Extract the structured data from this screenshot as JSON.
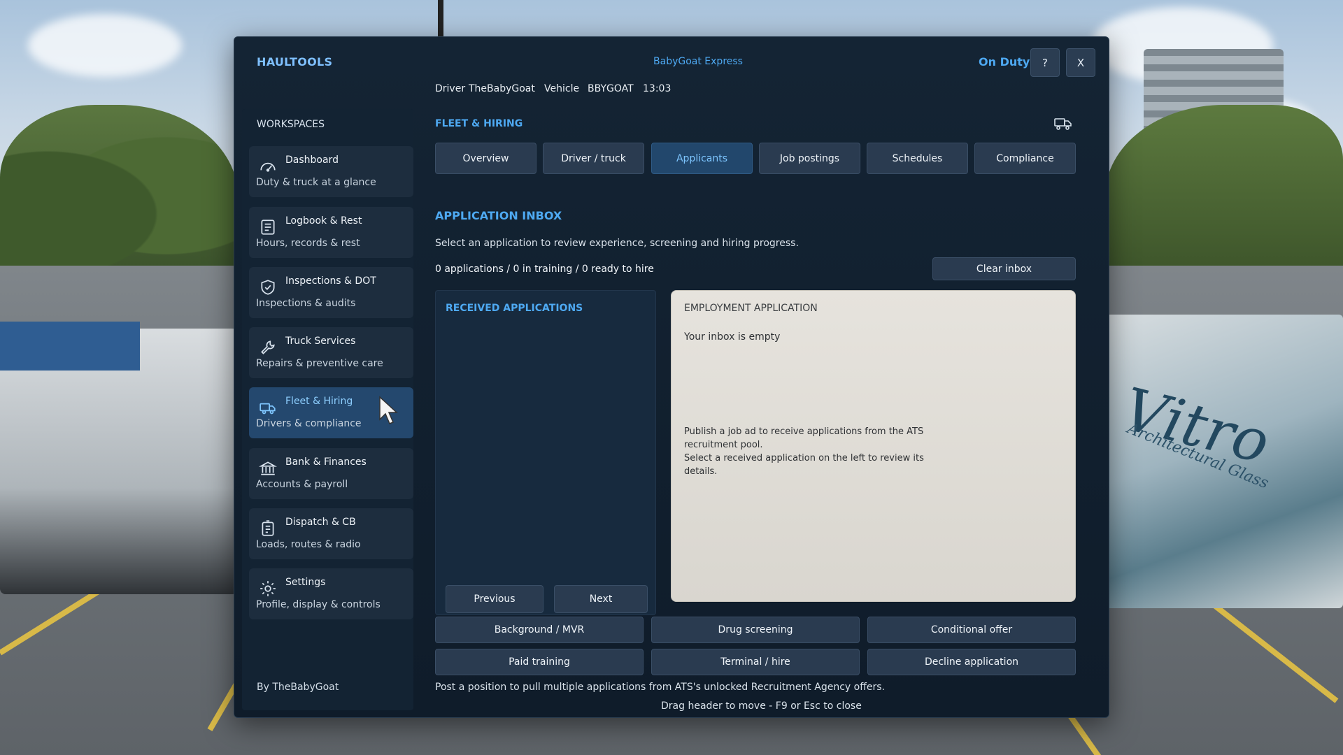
{
  "header": {
    "brand": "HAULTOOLS",
    "company": "BabyGoat Express",
    "status": "On Duty",
    "help_label": "?",
    "close_label": "X",
    "driver_label": "Driver",
    "driver_name": "TheBabyGoat",
    "vehicle_label": "Vehicle",
    "vehicle_id": "BBYGOAT",
    "clock": "13:03"
  },
  "sidebar": {
    "title": "WORKSPACES",
    "items": [
      {
        "label": "Dashboard",
        "sub": "Duty & truck at a glance",
        "icon": "gauge-icon"
      },
      {
        "label": "Logbook & Rest",
        "sub": "Hours, records & rest",
        "icon": "logbook-icon"
      },
      {
        "label": "Inspections & DOT",
        "sub": "Inspections & audits",
        "icon": "shield-check-icon"
      },
      {
        "label": "Truck Services",
        "sub": "Repairs & preventive care",
        "icon": "wrench-icon"
      },
      {
        "label": "Fleet & Hiring",
        "sub": "Drivers & compliance",
        "icon": "truck-icon",
        "active": true
      },
      {
        "label": "Bank & Finances",
        "sub": "Accounts & payroll",
        "icon": "bank-icon"
      },
      {
        "label": "Dispatch & CB",
        "sub": "Loads, routes & radio",
        "icon": "dispatch-icon"
      },
      {
        "label": "Settings",
        "sub": "Profile, display & controls",
        "icon": "gear-icon"
      }
    ],
    "byline": "By TheBabyGoat"
  },
  "section": {
    "title": "FLEET & HIRING",
    "icon": "truck-icon"
  },
  "tabs": [
    {
      "label": "Overview"
    },
    {
      "label": "Driver / truck"
    },
    {
      "label": "Applicants",
      "active": true
    },
    {
      "label": "Job postings"
    },
    {
      "label": "Schedules"
    },
    {
      "label": "Compliance"
    }
  ],
  "inbox": {
    "title": "APPLICATION INBOX",
    "description": "Select an application to review experience, screening and hiring progress.",
    "counts": "0 applications / 0 in training / 0 ready to hire",
    "clear_label": "Clear inbox",
    "received_title": "RECEIVED APPLICATIONS",
    "prev_label": "Previous",
    "next_label": "Next"
  },
  "application": {
    "title": "EMPLOYMENT APPLICATION",
    "empty": "Your inbox is empty",
    "hint_line1": "Publish a job ad to receive applications from the ATS recruitment pool.",
    "hint_line2": "Select a received application on the left to review its details."
  },
  "actions": [
    {
      "label": "Background / MVR"
    },
    {
      "label": "Drug screening"
    },
    {
      "label": "Conditional offer"
    },
    {
      "label": "Paid training"
    },
    {
      "label": "Terminal / hire"
    },
    {
      "label": "Decline application"
    }
  ],
  "footer": {
    "note": "Post a position to pull multiple applications from ATS's unlocked Recruitment Agency offers.",
    "drag_hint": "Drag header to move - F9 or Esc to close"
  },
  "background": {
    "trailer_brand": "Vitro",
    "trailer_sub": "Architectural Glass"
  },
  "colors": {
    "accent": "#4ea9f2",
    "panel": "#142434",
    "active_nav": "#24486e"
  }
}
